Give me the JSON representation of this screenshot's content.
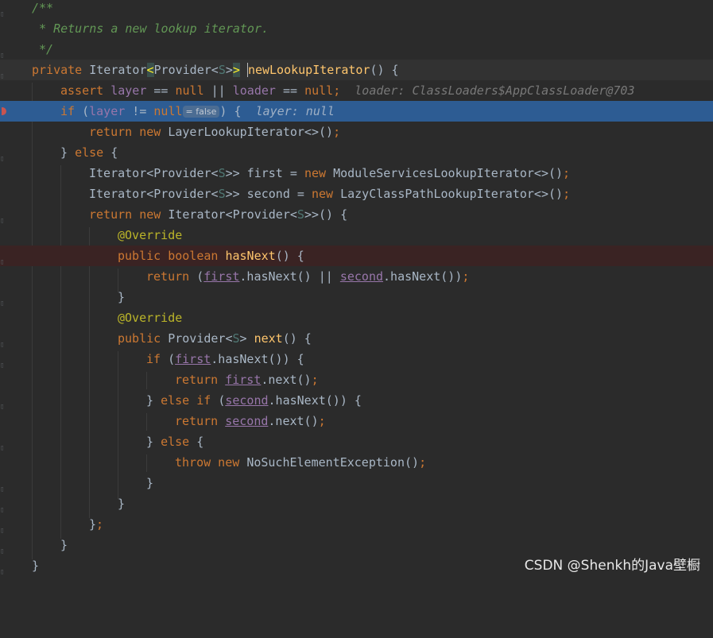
{
  "editor": {
    "lines": {
      "l1_comment_open": "/**",
      "l2_comment_text": " * Returns a new lookup iterator.",
      "l3_comment_close": " */",
      "l4_private": "private ",
      "l4_type": "Iterator",
      "l4_lt": "<",
      "l4_provider": "Provider<",
      "l4_s": "S",
      "l4_gt1": ">",
      "l4_gt2": ">",
      "l4_space": " ",
      "l4_method": "newLookupIterator",
      "l4_rest": "() {",
      "l5_assert": "assert ",
      "l5_layer": "layer",
      "l5_eq1": " == ",
      "l5_null1": "null",
      "l5_or": " || ",
      "l5_loader": "loader",
      "l5_eq2": " == ",
      "l5_null2": "null",
      "l5_semi": ";",
      "l5_hint": "loader: ClassLoaders$AppClassLoader@703",
      "l6_if": "if ",
      "l6_paren": "(",
      "l6_layer": "layer",
      "l6_ne": " != ",
      "l6_null": "null",
      "l6_pill": "= false",
      "l6_close": ") {",
      "l6_hint": "layer: null",
      "l7_return": "return new ",
      "l7_rest": "LayerLookupIterator<>()",
      "l7_semi": ";",
      "l8_close": "} ",
      "l8_else": "else",
      "l8_brace": " {",
      "l9_type": "Iterator<Provider<",
      "l9_s": "S",
      "l9_mid": ">> first = ",
      "l9_new": "new ",
      "l9_rest": "ModuleServicesLookupIterator<>()",
      "l9_semi": ";",
      "l10_type": "Iterator<Provider<",
      "l10_s": "S",
      "l10_mid": ">> second = ",
      "l10_new": "new ",
      "l10_rest": "LazyClassPathLookupIterator<>()",
      "l10_semi": ";",
      "l11_return": "return new ",
      "l11_type": "Iterator<Provider<",
      "l11_s": "S",
      "l11_rest": ">>() {",
      "l12_ann": "@Override",
      "l13_public": "public boolean ",
      "l13_method": "hasNext",
      "l13_rest": "() {",
      "l14_return": "return ",
      "l14_p": "(",
      "l14_first": "first",
      "l14_mid": ".hasNext() || ",
      "l14_second": "second",
      "l14_end": ".hasNext())",
      "l14_semi": ";",
      "l15_close": "}",
      "l16_ann": "@Override",
      "l17_public": "public ",
      "l17_type": "Provider<",
      "l17_s": "S",
      "l17_gt": "> ",
      "l17_method": "next",
      "l17_rest": "() {",
      "l18_if": "if ",
      "l18_p": "(",
      "l18_first": "first",
      "l18_rest": ".hasNext()) {",
      "l19_return": "return ",
      "l19_first": "first",
      "l19_rest": ".next()",
      "l19_semi": ";",
      "l20_close": "} ",
      "l20_elseif": "else if ",
      "l20_p": "(",
      "l20_second": "second",
      "l20_rest": ".hasNext()) {",
      "l21_return": "return ",
      "l21_second": "second",
      "l21_rest": ".next()",
      "l21_semi": ";",
      "l22_close": "} ",
      "l22_else": "else",
      "l22_brace": " {",
      "l23_throw": "throw new ",
      "l23_rest": "NoSuchElementException()",
      "l23_semi": ";",
      "l24_close": "}",
      "l25_close": "}",
      "l26_close": "}",
      "l26_semi": ";",
      "l27_close": "}",
      "l28_close": "}"
    }
  },
  "watermark": "CSDN @Shenkh的Java壁橱",
  "colors": {
    "background": "#2b2b2b",
    "execution_line": "#2d5c93",
    "breakpoint_line": "#3a2323",
    "keyword": "#cc7832",
    "method": "#ffc66d",
    "field": "#9876aa",
    "comment": "#629755",
    "annotation": "#bbb529"
  }
}
